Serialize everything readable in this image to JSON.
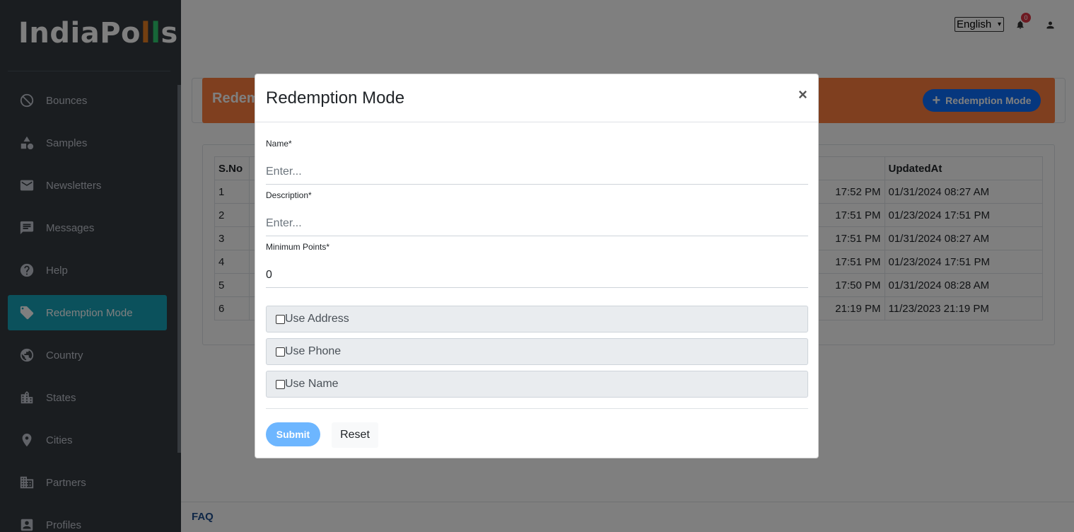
{
  "app": {
    "logo_text_a": "IndiaPo",
    "logo_text_b": "l",
    "logo_text_c": "l",
    "logo_text_d": "s"
  },
  "sidebar": {
    "items": [
      {
        "label": "Bounces",
        "icon": "ban-icon"
      },
      {
        "label": "Samples",
        "icon": "shapes-icon"
      },
      {
        "label": "Newsletters",
        "icon": "envelope-icon"
      },
      {
        "label": "Messages",
        "icon": "message-icon"
      },
      {
        "label": "Help",
        "icon": "help-icon"
      },
      {
        "label": "Redemption Mode",
        "icon": "tag-icon",
        "active": true
      },
      {
        "label": "Country",
        "icon": "globe-icon"
      },
      {
        "label": "States",
        "icon": "city-icon"
      },
      {
        "label": "Cities",
        "icon": "location-pin-icon"
      },
      {
        "label": "Partners",
        "icon": "building-icon"
      },
      {
        "label": "Profiles",
        "icon": "profile-icon"
      }
    ]
  },
  "topbar": {
    "language": "English",
    "notification_count": "0"
  },
  "page": {
    "title": "Redemption Mode",
    "add_button_label": "Redemption Mode",
    "table": {
      "headers": [
        "S.No",
        "",
        "UpdatedAt"
      ],
      "rows": [
        {
          "sno": "1",
          "created": "17:52 PM",
          "updated": "01/31/2024 08:27 AM"
        },
        {
          "sno": "2",
          "created": "17:51 PM",
          "updated": "01/23/2024 17:51 PM"
        },
        {
          "sno": "3",
          "created": "17:51 PM",
          "updated": "01/31/2024 08:27 AM"
        },
        {
          "sno": "4",
          "created": "17:51 PM",
          "updated": "01/23/2024 17:51 PM"
        },
        {
          "sno": "5",
          "created": "17:50 PM",
          "updated": "01/31/2024 08:28 AM"
        },
        {
          "sno": "6",
          "created": "21:19 PM",
          "updated": "11/23/2023 21:19 PM"
        }
      ]
    }
  },
  "footer": {
    "faq_label": "FAQ"
  },
  "modal": {
    "title": "Redemption Mode",
    "close_label": "×",
    "name_label": "Name*",
    "name_placeholder": "Enter...",
    "description_label": "Description*",
    "description_placeholder": "Enter...",
    "min_points_label": "Minimum Points*",
    "min_points_value": "0",
    "checkboxes": [
      {
        "label": "Use Address",
        "checked": false
      },
      {
        "label": "Use Phone",
        "checked": false
      },
      {
        "label": "Use Name",
        "checked": false
      }
    ],
    "submit_label": "Submit",
    "reset_label": "Reset"
  }
}
